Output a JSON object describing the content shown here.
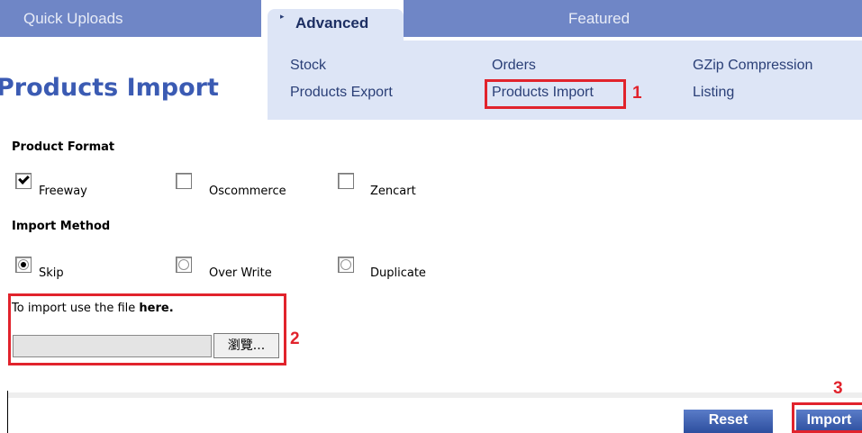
{
  "top_nav": {
    "quick_uploads": "Quick Uploads",
    "advanced": "Advanced",
    "featured": "Featured"
  },
  "advanced_menu": {
    "col1": [
      "Stock",
      "Products Export"
    ],
    "col2": [
      "Orders",
      "Products Import"
    ],
    "col3": [
      "GZip Compression",
      "Listing"
    ]
  },
  "page_title": "Products Import",
  "product_format": {
    "heading": "Product Format",
    "options": [
      {
        "label": "Freeway",
        "checked": true
      },
      {
        "label": "Oscommerce",
        "checked": false
      },
      {
        "label": "Zencart",
        "checked": false
      }
    ]
  },
  "import_method": {
    "heading": "Import Method",
    "options": [
      {
        "label": "Skip",
        "selected": true
      },
      {
        "label": "Over Write",
        "selected": false
      },
      {
        "label": "Duplicate",
        "selected": false
      }
    ]
  },
  "file_section": {
    "text_prefix": "To import use the file ",
    "text_link": "here.",
    "file_value": "",
    "browse_label": "瀏覽..."
  },
  "buttons": {
    "reset": "Reset",
    "import": "Import"
  },
  "annotations": [
    "1",
    "2",
    "3"
  ],
  "colors": {
    "nav_bar": "#6f86c6",
    "active_tab_bg": "#dde5f6",
    "title": "#3b5bb3",
    "annotation_red": "#e1232c"
  }
}
